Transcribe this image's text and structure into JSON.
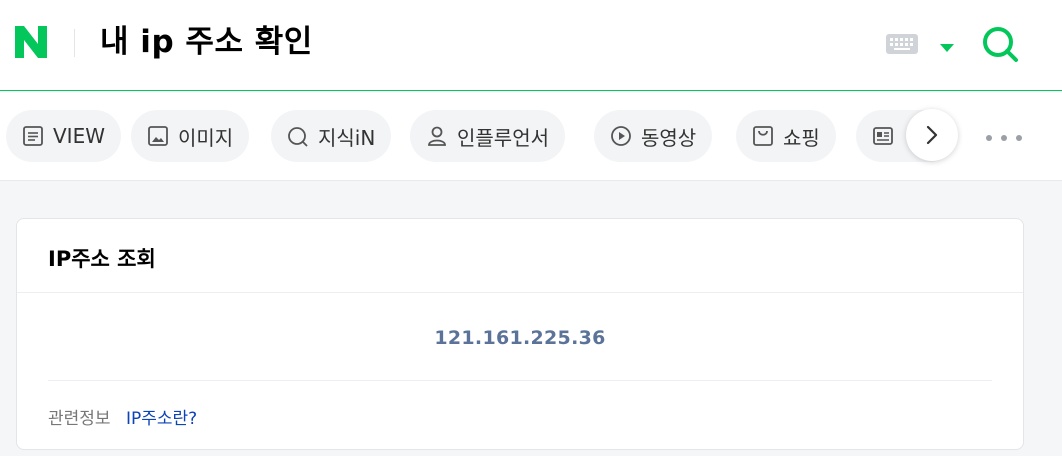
{
  "header": {
    "logo_letter": "N",
    "search_query": "내 ip 주소 확인",
    "brand_color": "#03c75a"
  },
  "icons": {
    "keyboard": "keyboard-icon",
    "dropdown": "caret-down-icon",
    "search": "search-icon",
    "next": "chevron-right-icon",
    "more": "more-dots-icon"
  },
  "tabs": [
    {
      "label": "VIEW",
      "icon": "document-icon"
    },
    {
      "label": "이미지",
      "icon": "image-icon"
    },
    {
      "label": "지식iN",
      "icon": "question-icon"
    },
    {
      "label": "인플루언서",
      "icon": "person-icon"
    },
    {
      "label": "동영상",
      "icon": "play-icon"
    },
    {
      "label": "쇼핑",
      "icon": "shopping-bag-icon"
    },
    {
      "label": "",
      "icon": "news-icon"
    }
  ],
  "ip_card": {
    "title": "IP주소 조회",
    "ip_address": "121.161.225.36",
    "related_label": "관련정보",
    "related_link": "IP주소란?",
    "ip_color": "#5b7399",
    "link_color": "#0c43b7"
  }
}
